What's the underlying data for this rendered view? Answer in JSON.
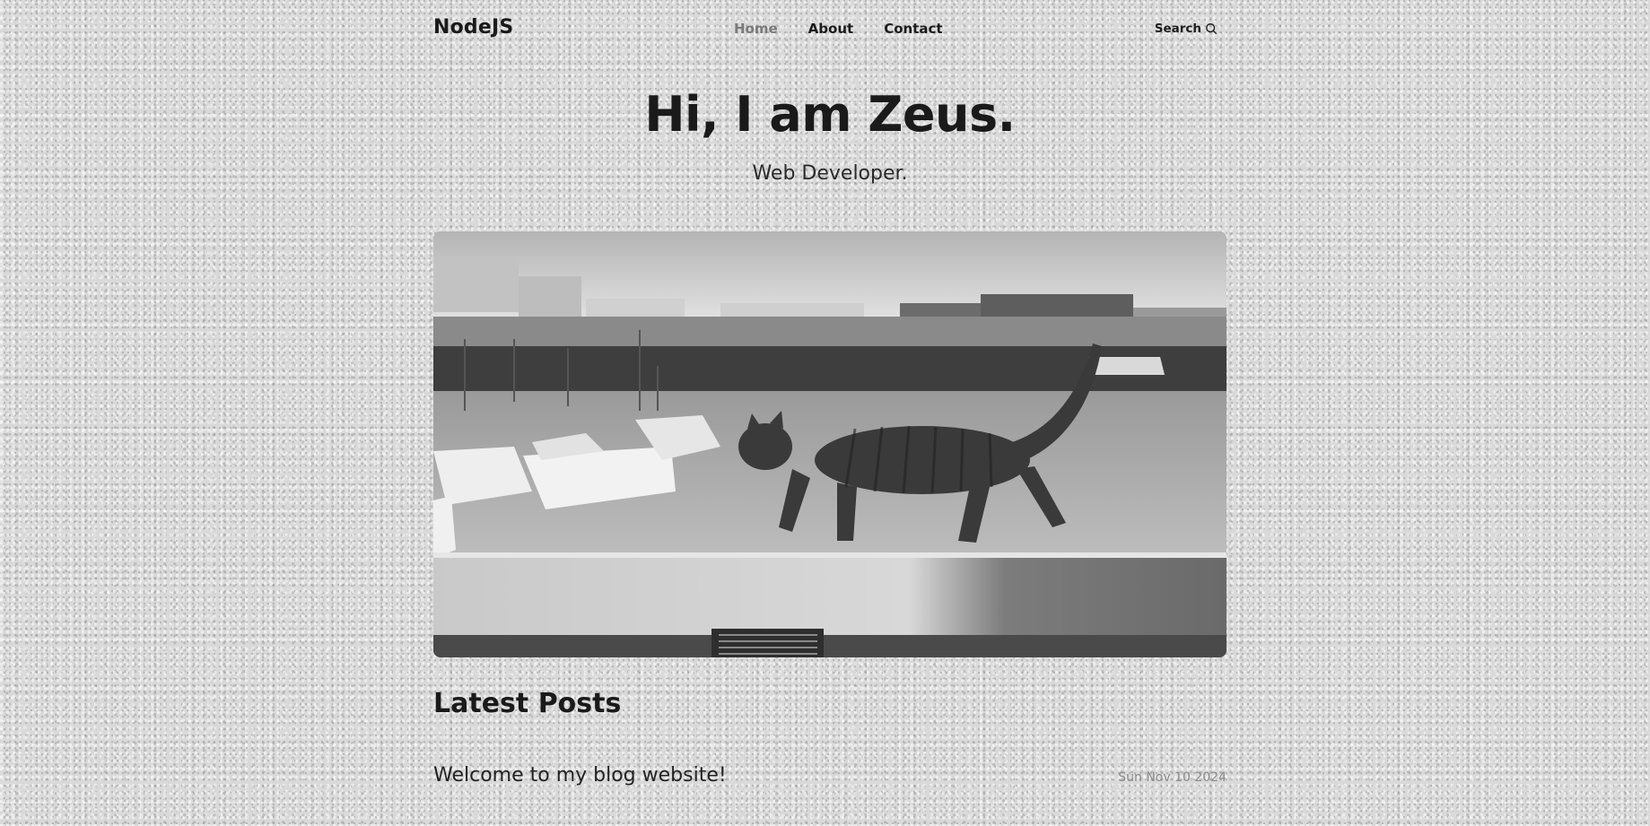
{
  "header": {
    "logo": "NodeJS",
    "nav": [
      {
        "label": "Home",
        "active": true
      },
      {
        "label": "About",
        "active": false
      },
      {
        "label": "Contact",
        "active": false
      }
    ],
    "search_label": "Search"
  },
  "hero": {
    "title": "Hi, I am Zeus.",
    "subtitle": "Web Developer.",
    "image": "cat-walking-on-harbor-wall-photo"
  },
  "latest_posts": {
    "heading": "Latest Posts",
    "posts": [
      {
        "title": "Welcome to my blog website!",
        "date": "Sun Nov 10 2024"
      }
    ]
  },
  "icons": {
    "search": "search-icon"
  },
  "colors": {
    "text": "#1c1c1c",
    "nav_active": "#7a7a7a",
    "date": "#8a8a8a"
  }
}
